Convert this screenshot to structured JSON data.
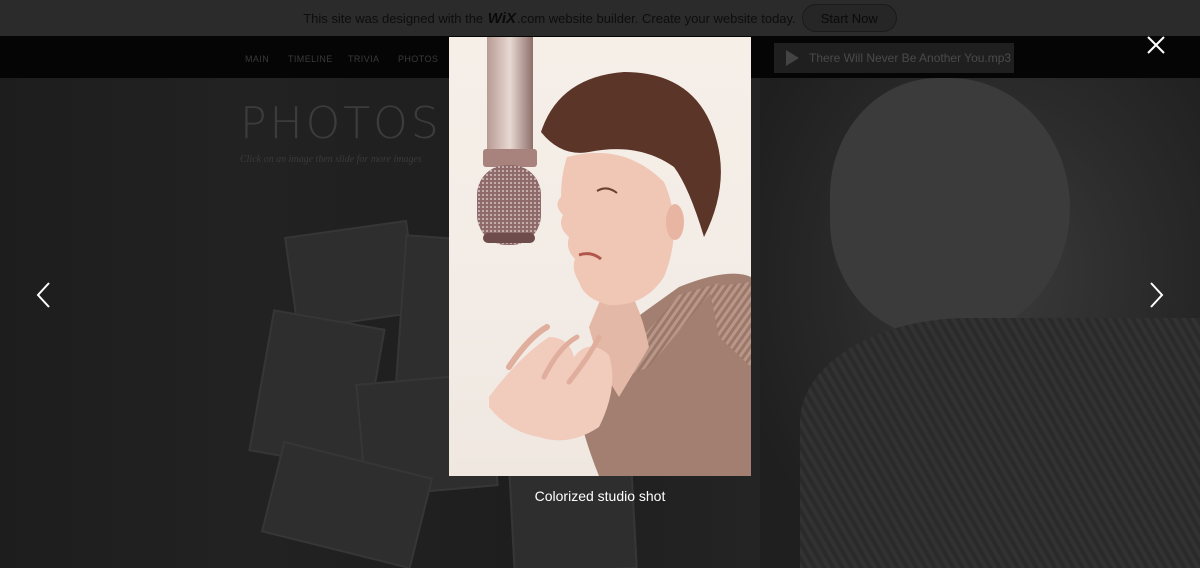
{
  "wix_banner": {
    "message_before": "This site was designed with the",
    "logo": "WiX",
    "message_after": ".com website builder. Create your website today.",
    "start_button": "Start Now"
  },
  "site_nav": {
    "items": [
      "MAIN",
      "TIMELINE",
      "TRIVIA",
      "PHOTOS"
    ]
  },
  "player": {
    "track": "There Will Never Be Another You.mp3",
    "icon": "play-icon"
  },
  "page": {
    "title": "PHOTOS",
    "hint": "Click on an image then slide for more images"
  },
  "lightbox": {
    "caption": "Colorized studio shot",
    "icons": {
      "close": "close-icon",
      "prev": "chevron-left-icon",
      "next": "chevron-right-icon"
    }
  },
  "colors": {
    "overlay": "#1b1b1b",
    "caption": "#ffffff",
    "arrows": "#ffffff"
  }
}
